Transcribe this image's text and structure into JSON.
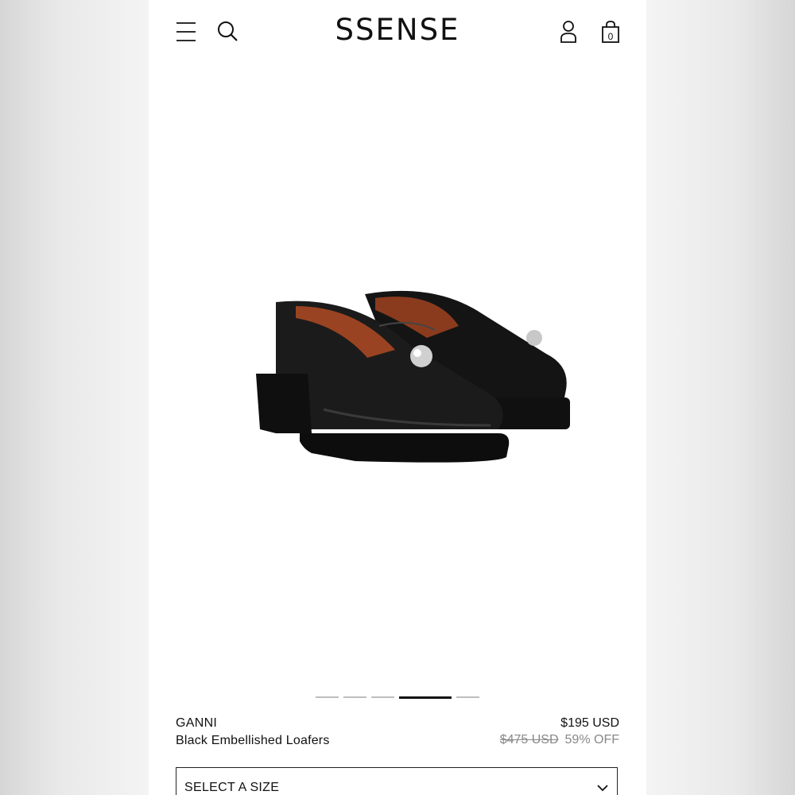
{
  "header": {
    "logo": "SSENSE",
    "icons": [
      "menu-icon",
      "search-icon",
      "account-icon",
      "bag-icon"
    ],
    "bag_count": "0"
  },
  "product": {
    "brand": "GANNI",
    "name": "Black Embellished Loafers",
    "price": "$195 USD",
    "original_price": "$475 USD",
    "discount": "59% OFF",
    "image": "black-embellished-loafers"
  },
  "carousel": {
    "total": 5,
    "active_index": 3
  },
  "size_select": {
    "label": "SELECT A SIZE"
  }
}
